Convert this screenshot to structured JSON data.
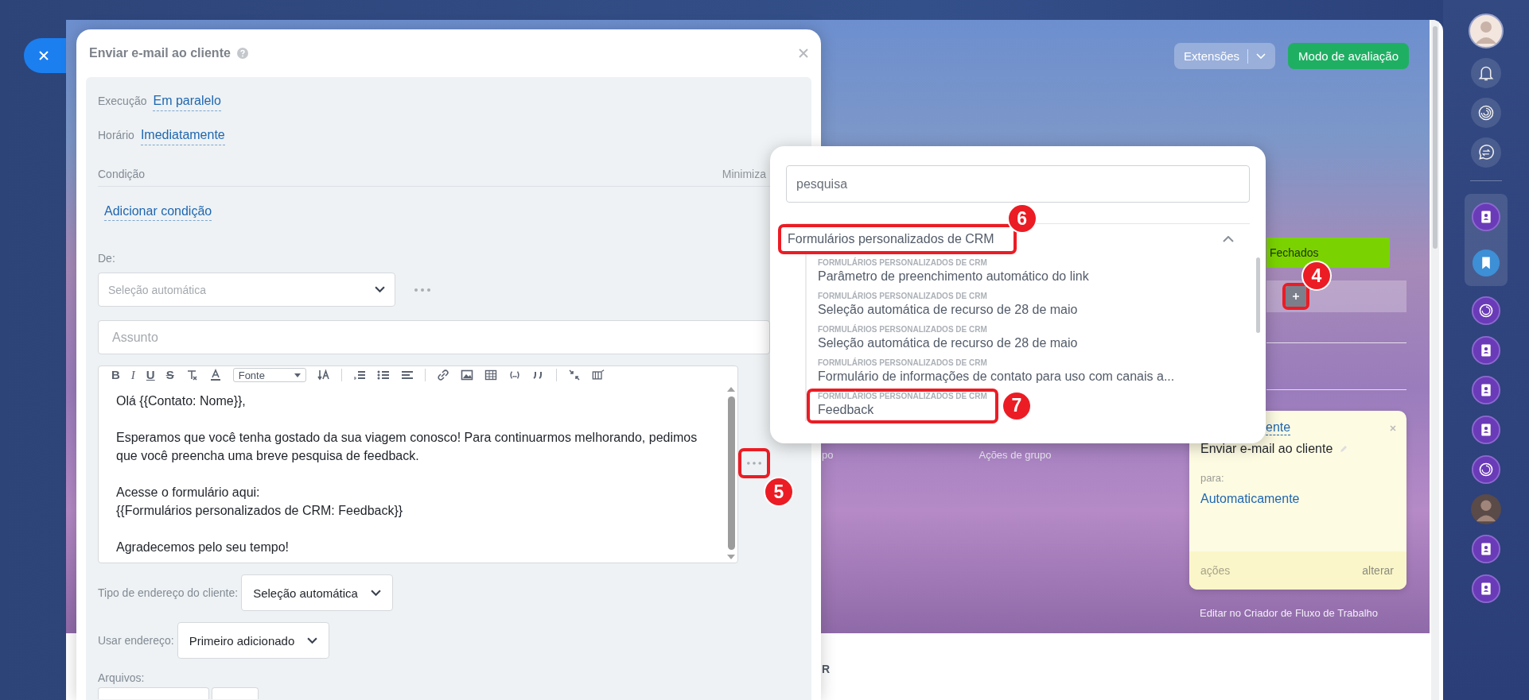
{
  "modal": {
    "title": "Enviar e-mail ao cliente",
    "settings": [
      {
        "label": "Execução",
        "value": "Em paralelo"
      },
      {
        "label": "Horário",
        "value": "Imediatamente"
      }
    ],
    "condition": {
      "label": "Condição",
      "toggle": "Minimiza",
      "link": "Adicionar condição"
    },
    "from": {
      "label": "De:",
      "placeholder": "Seleção automática"
    },
    "subject": {
      "placeholder": "Assunto"
    },
    "editor": {
      "toolbar": [
        "B",
        "I",
        "U",
        "S"
      ],
      "font_select": "Fonte",
      "paragraphs": [
        [
          "Olá {{Contato: Nome}},"
        ],
        [
          "Esperamos que você tenha gostado da sua viagem conosco! Para continuarmos melhorando, pedimos",
          "que você preencha uma breve pesquisa de feedback."
        ],
        [
          "Acesse o formulário aqui:",
          "{{Formulários personalizados de CRM: Feedback}}"
        ],
        [
          "Agradecemos pelo seu tempo!"
        ]
      ]
    },
    "insert_button": {
      "marker": "5"
    },
    "address_type": {
      "label": "Tipo de endereço do cliente:",
      "value": "Seleção automática"
    },
    "use_address": {
      "label": "Usar endereço:",
      "value": "Primeiro adicionado"
    },
    "files": {
      "label": "Arquivos:"
    }
  },
  "popup": {
    "search": {
      "placeholder": "pesquisa"
    },
    "groups": [
      {
        "title": "Formulários personalizados de CRM",
        "expanded": true,
        "marker": "6",
        "items": [
          {
            "category": "FORMULÁRIOS PERSONALIZADOS DE CRM",
            "label": "Parâmetro de preenchimento automático do link"
          },
          {
            "category": "FORMULÁRIOS PERSONALIZADOS DE CRM",
            "label": "Seleção automática de recurso de 28 de maio"
          },
          {
            "category": "FORMULÁRIOS PERSONALIZADOS DE CRM",
            "label": "Seleção automática de recurso de 28 de maio"
          },
          {
            "category": "FORMULÁRIOS PERSONALIZADOS DE CRM",
            "label": "Formulário de informações de contato para uso com canais a..."
          },
          {
            "category": "FORMULÁRIOS PERSONALIZADOS DE CRM",
            "label": "Feedback",
            "marker": "7"
          }
        ]
      }
    ]
  },
  "header": {
    "extensions": "Extensões",
    "trial": "Modo de avaliação"
  },
  "stage": {
    "label": "Fechados"
  },
  "add_button": {
    "marker": "4"
  },
  "group_bar": {
    "column_1": "po",
    "column_2": "Ações de grupo"
  },
  "card": {
    "link": "ente",
    "title": "Enviar e-mail ao cliente",
    "to_label": "para:",
    "to_value": "Automaticamente",
    "actions": "ações",
    "change": "alterar"
  },
  "edit_link": "Editar no Criador de Fluxo de Trabalho",
  "footer_text": "R"
}
